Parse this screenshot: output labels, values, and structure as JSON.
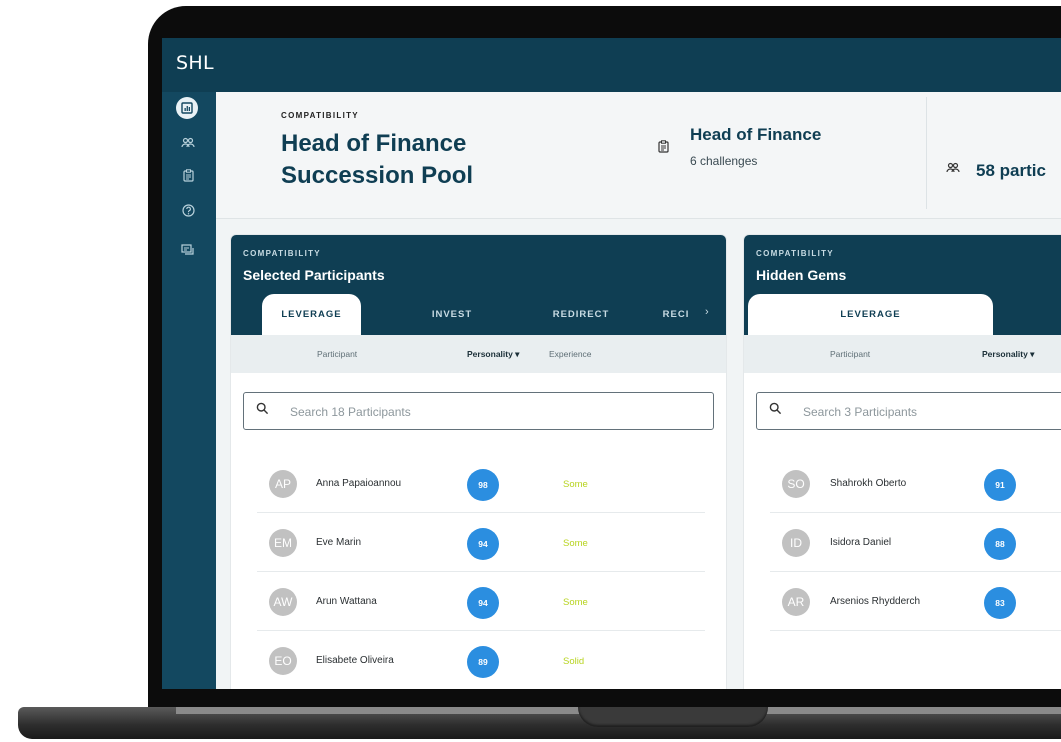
{
  "app": {
    "logo": "SHL"
  },
  "sidebar": {
    "icons": [
      "dashboard-icon",
      "people-icon",
      "clipboard-icon",
      "help-icon",
      "chat-icon"
    ]
  },
  "header": {
    "kicker": "COMPATIBILITY",
    "title": "Head of Finance Succession Pool",
    "role_title": "Head of Finance",
    "role_sub": "6 challenges",
    "participants": "58 partic"
  },
  "panels": [
    {
      "kicker": "COMPATIBILITY",
      "title": "Selected Participants",
      "tabs": [
        "LEVERAGE",
        "INVEST",
        "REDIRECT",
        "RECI"
      ],
      "active_tab": "LEVERAGE",
      "columns": {
        "participant": "Participant",
        "personality": "Personality ▾",
        "experience": "Experience"
      },
      "search_placeholder": "Search 18 Participants",
      "rows": [
        {
          "initials": "AP",
          "name": "Anna Papaioannou",
          "score": "98",
          "experience": "Some"
        },
        {
          "initials": "EM",
          "name": "Eve Marin",
          "score": "94",
          "experience": "Some"
        },
        {
          "initials": "AW",
          "name": "Arun Wattana",
          "score": "94",
          "experience": "Some"
        },
        {
          "initials": "EO",
          "name": "Elisabete Oliveira",
          "score": "89",
          "experience": "Solid"
        }
      ]
    },
    {
      "kicker": "COMPATIBILITY",
      "title": "Hidden Gems",
      "tabs": [
        "LEVERAGE"
      ],
      "active_tab": "LEVERAGE",
      "columns": {
        "participant": "Participant",
        "personality": "Personality ▾"
      },
      "search_placeholder": "Search 3 Participants",
      "rows": [
        {
          "initials": "SO",
          "name": "Shahrokh Oberto",
          "score": "91"
        },
        {
          "initials": "ID",
          "name": "Isidora Daniel",
          "score": "88"
        },
        {
          "initials": "AR",
          "name": "Arsenios Rhydderch",
          "score": "83"
        }
      ]
    }
  ],
  "colors": {
    "navy": "#0f3e53",
    "sidebar": "#134860",
    "score_blue": "#2b8ee0",
    "experience_green": "#b8d421",
    "avatar_grey": "#c1c1c1"
  }
}
